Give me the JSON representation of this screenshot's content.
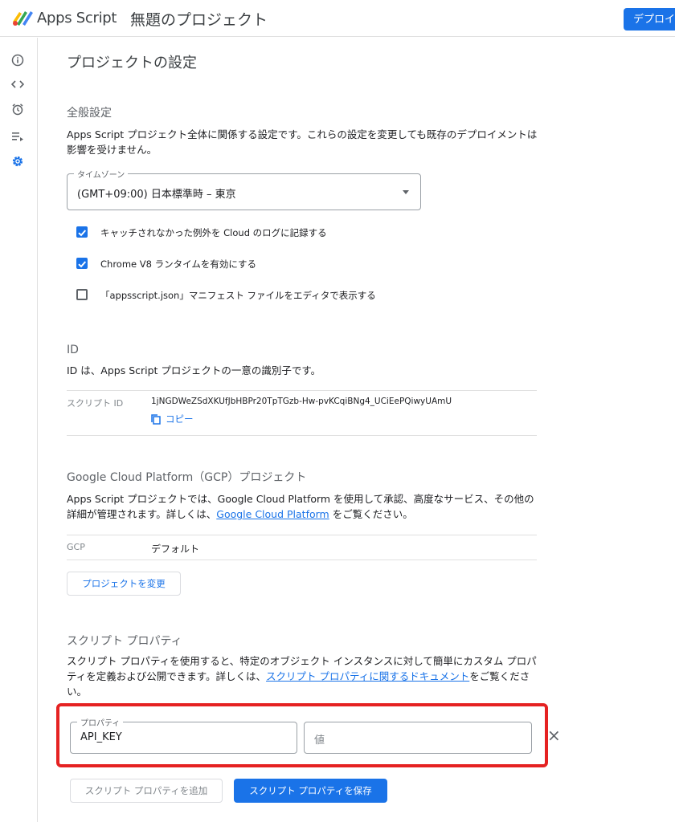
{
  "header": {
    "app_name": "Apps Script",
    "project_name": "無題のプロジェクト",
    "deploy_label": "デプロイ"
  },
  "sidebar": {
    "items": [
      {
        "icon": "info-icon"
      },
      {
        "icon": "code-icon"
      },
      {
        "icon": "alarm-icon"
      },
      {
        "icon": "executions-icon"
      },
      {
        "icon": "gear-icon",
        "active": true
      }
    ]
  },
  "page": {
    "title": "プロジェクトの設定"
  },
  "general": {
    "title": "全般設定",
    "description": "Apps Script プロジェクト全体に関係する設定です。これらの設定を変更しても既存のデプロイメントは影響を受けません。",
    "timezone_label": "タイムゾーン",
    "timezone_value": "(GMT+09:00) 日本標準時 – 東京",
    "checkboxes": [
      {
        "label": "キャッチされなかった例外を Cloud のログに記録する",
        "checked": true
      },
      {
        "label": "Chrome V8 ランタイムを有効にする",
        "checked": true
      },
      {
        "label": "「appsscript.json」マニフェスト ファイルをエディタで表示する",
        "checked": false
      }
    ]
  },
  "ids": {
    "title": "ID",
    "description": "ID は、Apps Script プロジェクトの一意の識別子です。",
    "script_id_label": "スクリプト ID",
    "script_id_value": "1jNGDWeZSdXKUfJbHBPr20TpTGzb-Hw-pvKCqiBNg4_UCiEePQiwyUAmU",
    "copy_label": "コピー"
  },
  "gcp": {
    "title": "Google Cloud Platform（GCP）プロジェクト",
    "description_pre": "Apps Script プロジェクトでは、Google Cloud Platform を使用して承認、高度なサービス、その他の詳細が管理されます。詳しくは、",
    "description_link": "Google Cloud Platform",
    "description_post": " をご覧ください。",
    "gcp_label": "GCP",
    "gcp_value": "デフォルト",
    "change_button": "プロジェクトを変更"
  },
  "props": {
    "title": "スクリプト プロパティ",
    "description_pre": "スクリプト プロパティを使用すると、特定のオブジェクト インスタンスに対して簡単にカスタム プロパティを定義および公開できます。詳しくは、",
    "description_link": "スクリプト プロパティに関するドキュメント",
    "description_post": "をご覧ください。",
    "property_label": "プロパティ",
    "property_value": "API_KEY",
    "value_placeholder": "値",
    "delete_icon": "×",
    "add_button": "スクリプト プロパティを追加",
    "save_button": "スクリプト プロパティを保存"
  },
  "colors": {
    "accent": "#1a73e8",
    "highlight": "#e52222"
  }
}
